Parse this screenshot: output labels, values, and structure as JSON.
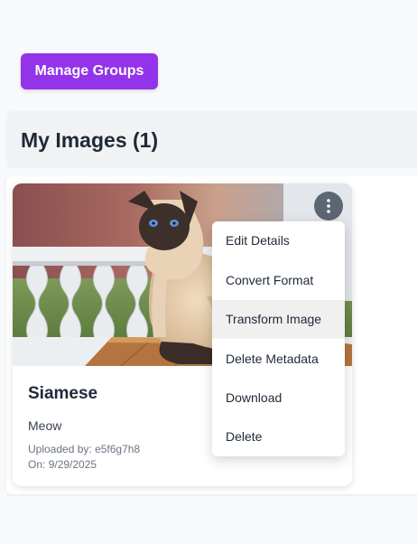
{
  "toolbar": {
    "manage_groups_label": "Manage Groups"
  },
  "section": {
    "title": "My Images (1)"
  },
  "card": {
    "title": "Siamese",
    "description": "Meow",
    "uploaded_by_label": "Uploaded by:",
    "uploaded_by_value": "e5f6g7h8",
    "date_label": "On:",
    "date_value": "9/29/2025",
    "image_subject": "siamese-cat-photo",
    "options_icon": "vertical-ellipsis-icon"
  },
  "menu": {
    "items": [
      {
        "label": "Edit Details"
      },
      {
        "label": "Convert Format"
      },
      {
        "label": "Transform Image",
        "highlighted": true
      },
      {
        "label": "Delete Metadata"
      },
      {
        "label": "Download"
      },
      {
        "label": "Delete"
      }
    ]
  },
  "colors": {
    "page_background": "#f8f9fb",
    "primary_button": "#9333ea",
    "section_header_background": "#f1f2f4",
    "menu_hover": "#f0f0f1",
    "title_text": "#1f2937",
    "meta_text": "#6b7280"
  }
}
